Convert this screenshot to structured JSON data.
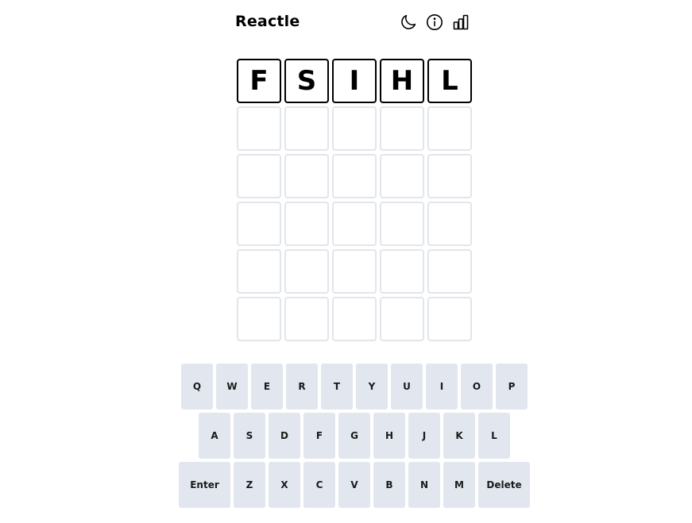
{
  "header": {
    "title": "Reactle",
    "icons": [
      "moon-icon",
      "info-icon",
      "chart-bar-icon"
    ]
  },
  "grid": {
    "rows": [
      [
        "F",
        "S",
        "I",
        "H",
        "L"
      ],
      [
        "",
        "",
        "",
        "",
        ""
      ],
      [
        "",
        "",
        "",
        "",
        ""
      ],
      [
        "",
        "",
        "",
        "",
        ""
      ],
      [
        "",
        "",
        "",
        "",
        ""
      ],
      [
        "",
        "",
        "",
        "",
        ""
      ]
    ]
  },
  "keyboard": {
    "row1": [
      "Q",
      "W",
      "E",
      "R",
      "T",
      "Y",
      "U",
      "I",
      "O",
      "P"
    ],
    "row2": [
      "A",
      "S",
      "D",
      "F",
      "G",
      "H",
      "J",
      "K",
      "L"
    ],
    "row3": [
      "Enter",
      "Z",
      "X",
      "C",
      "V",
      "B",
      "N",
      "M",
      "Delete"
    ]
  },
  "colors": {
    "empty_border": "#e2e5ea",
    "filled_border": "#000000",
    "key_background": "#e2e7ef"
  }
}
